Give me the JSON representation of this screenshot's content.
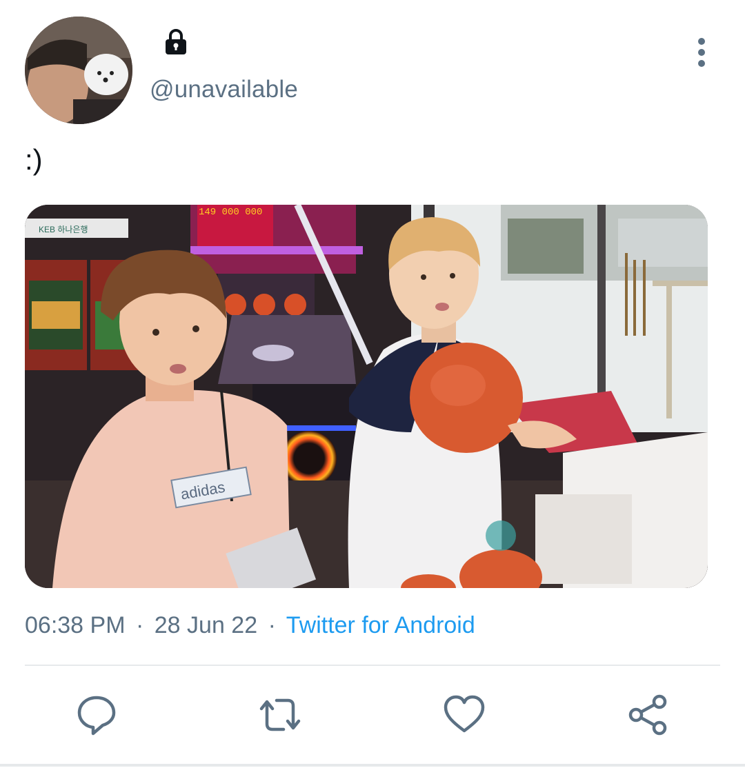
{
  "tweet": {
    "handle": "@unavailable",
    "text": ":)",
    "time": "06:38 PM",
    "separator": "·",
    "date": "28 Jun 22",
    "source": "Twitter for Android"
  },
  "media": {
    "arcade_sign": "KEB 하나은행",
    "shirt_text": "adidas",
    "scoreboard": "149 000 000"
  },
  "icons": {
    "lock": "lock-icon",
    "more": "more-vertical-icon",
    "reply": "reply-icon",
    "retweet": "retweet-icon",
    "like": "heart-icon",
    "share": "share-icon"
  },
  "colors": {
    "handle": "#5b7083",
    "link": "#1d9bf0",
    "text": "#0f1419",
    "icon": "#5b7083",
    "divider": "#e6e9eb"
  }
}
